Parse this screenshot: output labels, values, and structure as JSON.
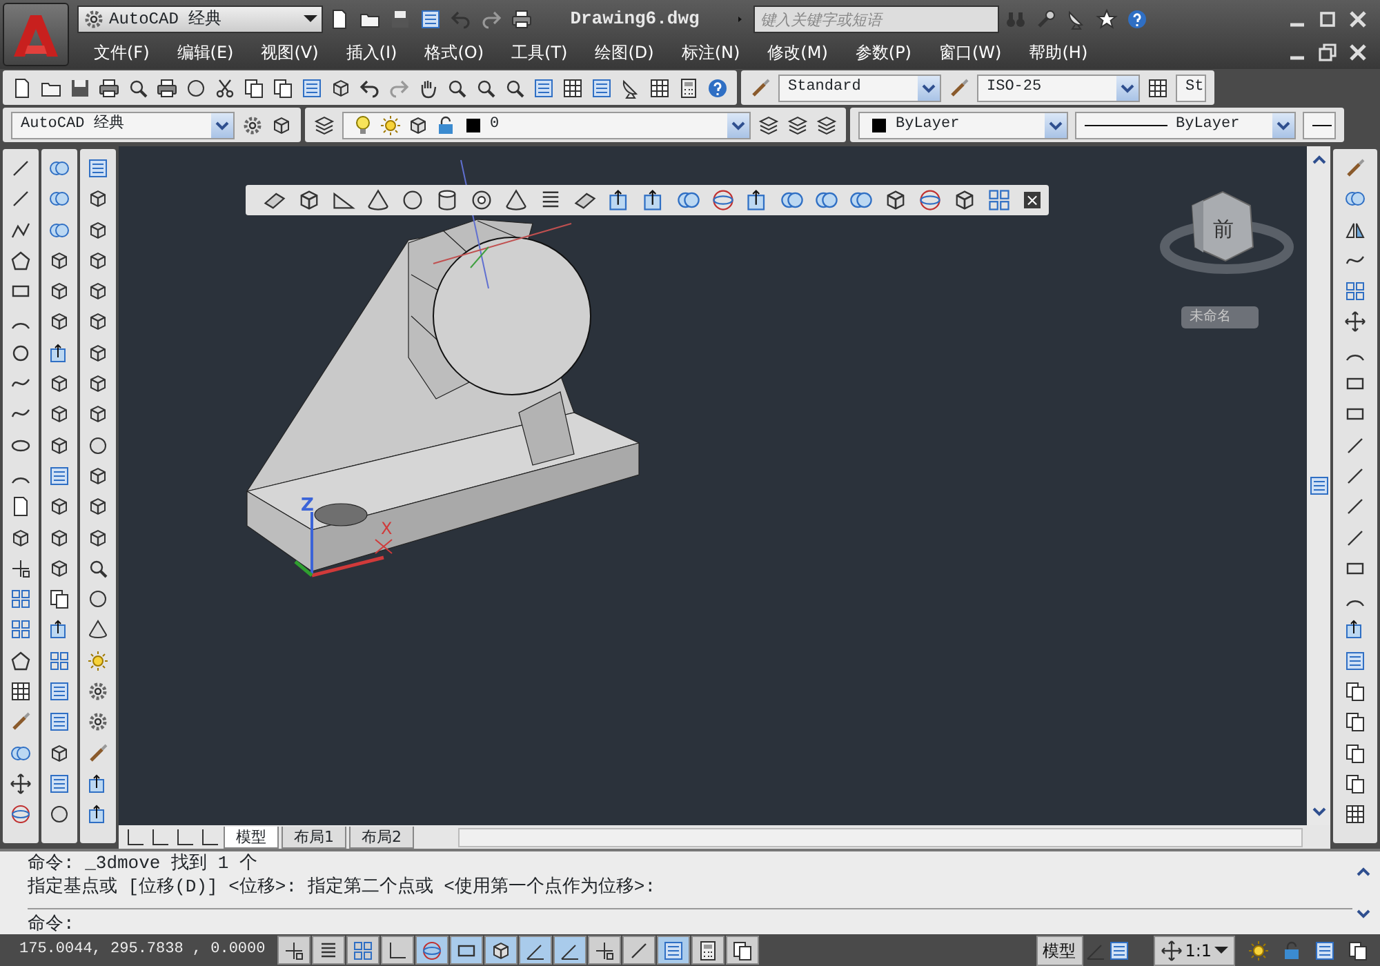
{
  "title_bar": {
    "workspace": "AutoCAD 经典",
    "title": "Drawing6.dwg",
    "search": {
      "placeholder": "键入关键字或短语"
    }
  },
  "menu": [
    "文件(F)",
    "编辑(E)",
    "视图(V)",
    "插入(I)",
    "格式(O)",
    "工具(T)",
    "绘图(D)",
    "标注(N)",
    "修改(M)",
    "参数(P)",
    "窗口(W)",
    "帮助(H)"
  ],
  "styles_toolbar": {
    "text_style": "Standard",
    "dim_style": "ISO-25",
    "table_style": "St"
  },
  "workspace_toolbar": {
    "workspace": "AutoCAD 经典"
  },
  "layers_toolbar": {
    "layer": "0"
  },
  "properties_toolbar": {
    "color_setting": "ByLayer",
    "linetype": "ByLayer"
  },
  "modeling_toolbar": {
    "close": "×"
  },
  "ucs": {
    "x_label": "X",
    "z_label": "Z"
  },
  "viewcube": {
    "face": "前",
    "view_menu": "未命名"
  },
  "layout_tabs": [
    {
      "label": "模型",
      "selected": true
    },
    {
      "label": "布局1",
      "selected": false
    },
    {
      "label": "布局2",
      "selected": false
    }
  ],
  "command_history": [
    "命令:  _3dmove 找到 1 个",
    "指定基点或 [位移(D)] <位移>:  指定第二个点或 <使用第一个点作为位移>:"
  ],
  "command_line": {
    "prompt": "命令:"
  },
  "status_bar": {
    "coordinates": "175.0044,  295.7838 , 0.0000",
    "toggles": [
      {
        "on": false
      },
      {
        "on": false
      },
      {
        "on": false
      },
      {
        "on": false
      },
      {
        "on": true
      },
      {
        "on": true
      },
      {
        "on": true
      },
      {
        "on": true
      },
      {
        "on": true
      },
      {
        "on": false
      },
      {
        "on": false
      },
      {
        "on": true
      },
      {
        "on": false
      },
      {
        "on": false
      }
    ],
    "model_label": "模型",
    "annotation_scale": "1:1"
  }
}
